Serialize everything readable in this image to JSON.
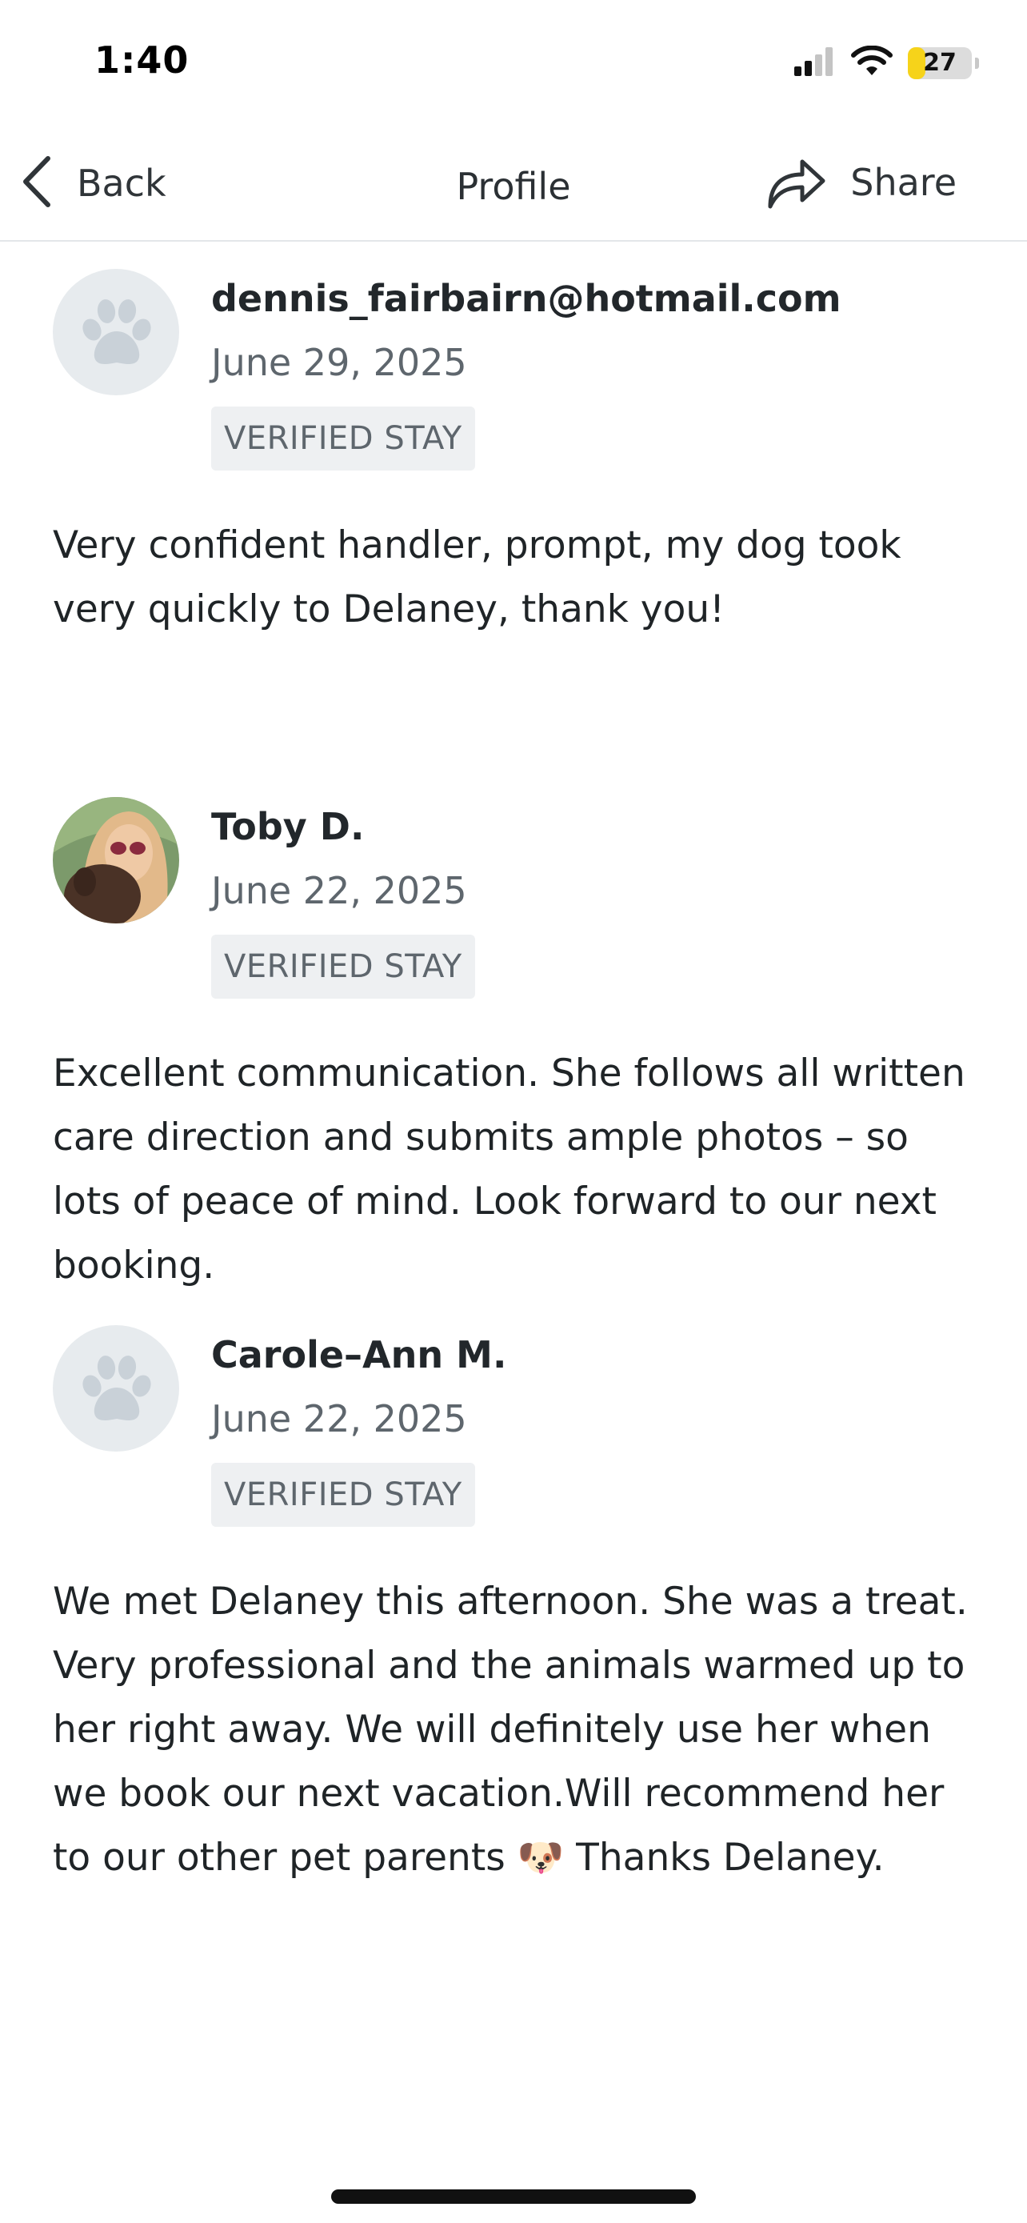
{
  "status_bar": {
    "time": "1:40",
    "battery_level": "27",
    "battery_percent": 27,
    "icons": [
      "cellular-signal-icon",
      "wifi-icon",
      "battery-icon"
    ]
  },
  "nav": {
    "back_label": "Back",
    "title": "Profile",
    "share_label": "Share"
  },
  "reviews": [
    {
      "reviewer": "dennis_fairbairn@hotmail.com",
      "date": "June 29, 2025",
      "badge": "VERIFIED STAY",
      "avatar": "paw-placeholder",
      "text": "Very confident handler, prompt, my dog took very quickly to Delaney, thank you!"
    },
    {
      "reviewer": "Toby D.",
      "date": "June 22, 2025",
      "badge": "VERIFIED STAY",
      "avatar": "photo",
      "text": "Excellent communication. She follows all written care direction and submits ample photos – so lots of peace of mind. Look forward to our next booking."
    },
    {
      "reviewer": "Carole–Ann M.",
      "date": "June 22, 2025",
      "badge": "VERIFIED STAY",
      "avatar": "paw-placeholder",
      "text": "We met Delaney this afternoon.  She was a treat. Very professional and the animals warmed up to her right away. We will definitely use her when we book our next vacation.Will recommend her to our other pet parents 🐶 Thanks Delaney."
    }
  ],
  "colors": {
    "accent_text": "#1f2427",
    "secondary_text": "#5e666d",
    "badge_bg": "#eef0f2",
    "avatar_bg": "#e7ebee",
    "paw": "#c9d1d8",
    "battery": "#f6d31a"
  }
}
